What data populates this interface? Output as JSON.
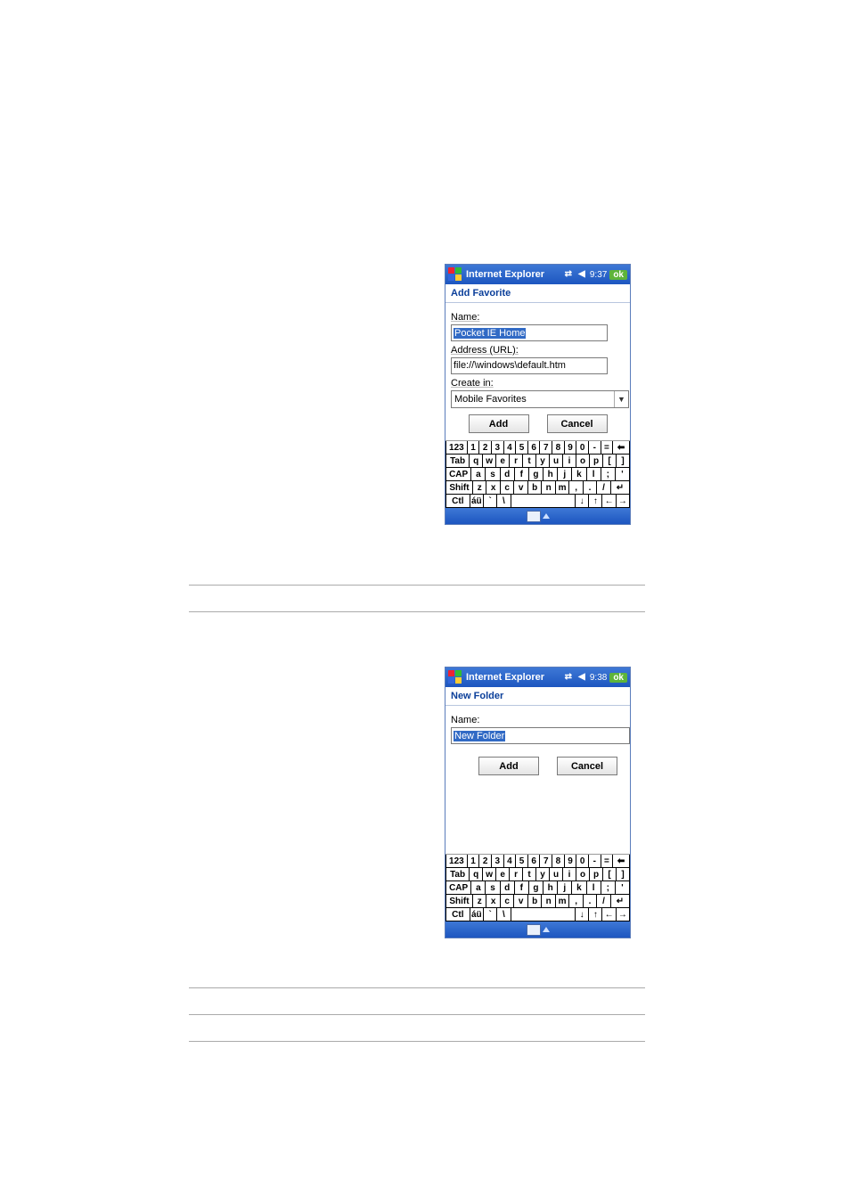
{
  "screen1": {
    "titlebar": {
      "title": "Internet Explorer",
      "time": "9:37",
      "ok": "ok"
    },
    "header": "Add Favorite",
    "name_label": "Name:",
    "name_value": "Pocket IE Home",
    "url_label": "Address (URL):",
    "url_value": "file://\\windows\\default.htm",
    "createin_label": "Create in:",
    "createin_value": "Mobile Favorites",
    "add_btn": "Add",
    "cancel_btn": "Cancel"
  },
  "screen2": {
    "titlebar": {
      "title": "Internet Explorer",
      "time": "9:38",
      "ok": "ok"
    },
    "header": "New Folder",
    "name_label": "Name:",
    "name_value": "New Folder",
    "add_btn": "Add",
    "cancel_btn": "Cancel"
  },
  "keyboard": {
    "row1": [
      "123",
      "1",
      "2",
      "3",
      "4",
      "5",
      "6",
      "7",
      "8",
      "9",
      "0",
      "-",
      "=",
      "⬅"
    ],
    "row2": [
      "Tab",
      "q",
      "w",
      "e",
      "r",
      "t",
      "y",
      "u",
      "i",
      "o",
      "p",
      "[",
      "]"
    ],
    "row3": [
      "CAP",
      "a",
      "s",
      "d",
      "f",
      "g",
      "h",
      "j",
      "k",
      "l",
      ";",
      "'"
    ],
    "row4": [
      "Shift",
      "z",
      "x",
      "c",
      "v",
      "b",
      "n",
      "m",
      ",",
      ".",
      "/",
      "↵"
    ],
    "row5": [
      "Ctl",
      "áü",
      "`",
      "\\",
      " ",
      "↓",
      "↑",
      "←",
      "→"
    ]
  }
}
